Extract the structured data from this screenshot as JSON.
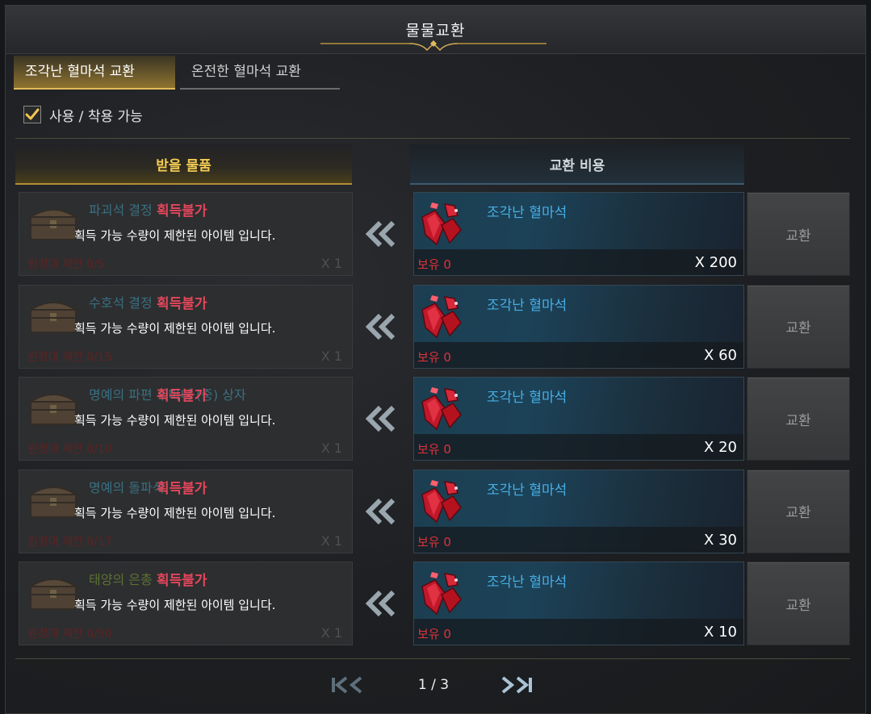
{
  "window": {
    "title": "물물교환"
  },
  "tabs": [
    {
      "label": "조각난 혈마석 교환",
      "active": true
    },
    {
      "label": "온전한 혈마석 교환",
      "active": false
    }
  ],
  "filter": {
    "label": "사용 / 착용 가능",
    "checked": true
  },
  "headers": {
    "reward": "받을 물품",
    "cost": "교환 비용"
  },
  "rows": [
    {
      "item_name": "파괴석 결정",
      "tooltip_title": "획득불가",
      "tooltip_desc": "획득 가능 수량이 제한된 아이템 입니다.",
      "limit": "원정대 제한 0/5",
      "reward_qty": "X 1",
      "cost_name": "조각난 혈마석",
      "owned": "보유 0",
      "cost_qty": "X 200",
      "button": "교환"
    },
    {
      "item_name": "수호석 결정",
      "tooltip_title": "획득불가",
      "tooltip_desc": "획득 가능 수량이 제한된 아이템 입니다.",
      "limit": "원정대 제한 0/15",
      "reward_qty": "X 1",
      "cost_name": "조각난 혈마석",
      "owned": "보유 0",
      "cost_qty": "X 60",
      "button": "교환"
    },
    {
      "item_name": "명예의 파편 주머니 (중) 상자",
      "tooltip_title": "획득불가",
      "tooltip_desc": "획득 가능 수량이 제한된 아이템 입니다.",
      "limit": "원정대 제한 0/10",
      "reward_qty": "X 1",
      "cost_name": "조각난 혈마석",
      "owned": "보유 0",
      "cost_qty": "X 20",
      "button": "교환"
    },
    {
      "item_name": "명예의 돌파석",
      "tooltip_title": "획득불가",
      "tooltip_desc": "획득 가능 수량이 제한된 아이템 입니다.",
      "limit": "원정대 제한 0/17",
      "reward_qty": "X 1",
      "cost_name": "조각난 혈마석",
      "owned": "보유 0",
      "cost_qty": "X 30",
      "button": "교환"
    },
    {
      "item_name": "태양의 은총",
      "tooltip_title": "획득불가",
      "tooltip_desc": "획득 가능 수량이 제한된 아이템 입니다.",
      "limit": "원정대 제한 0/30",
      "reward_qty": "X 1",
      "cost_name": "조각난 혈마석",
      "owned": "보유 0",
      "cost_qty": "X 10",
      "button": "교환"
    }
  ],
  "pagination": {
    "text": "1 / 3",
    "current": 1,
    "total": 3
  },
  "colors": {
    "tab_active": "#e0bc5c",
    "header_reward": "#f2cb52",
    "tooltip_title": "#e3465a",
    "owned": "#e0313b",
    "cost_name": "#46aee6"
  }
}
